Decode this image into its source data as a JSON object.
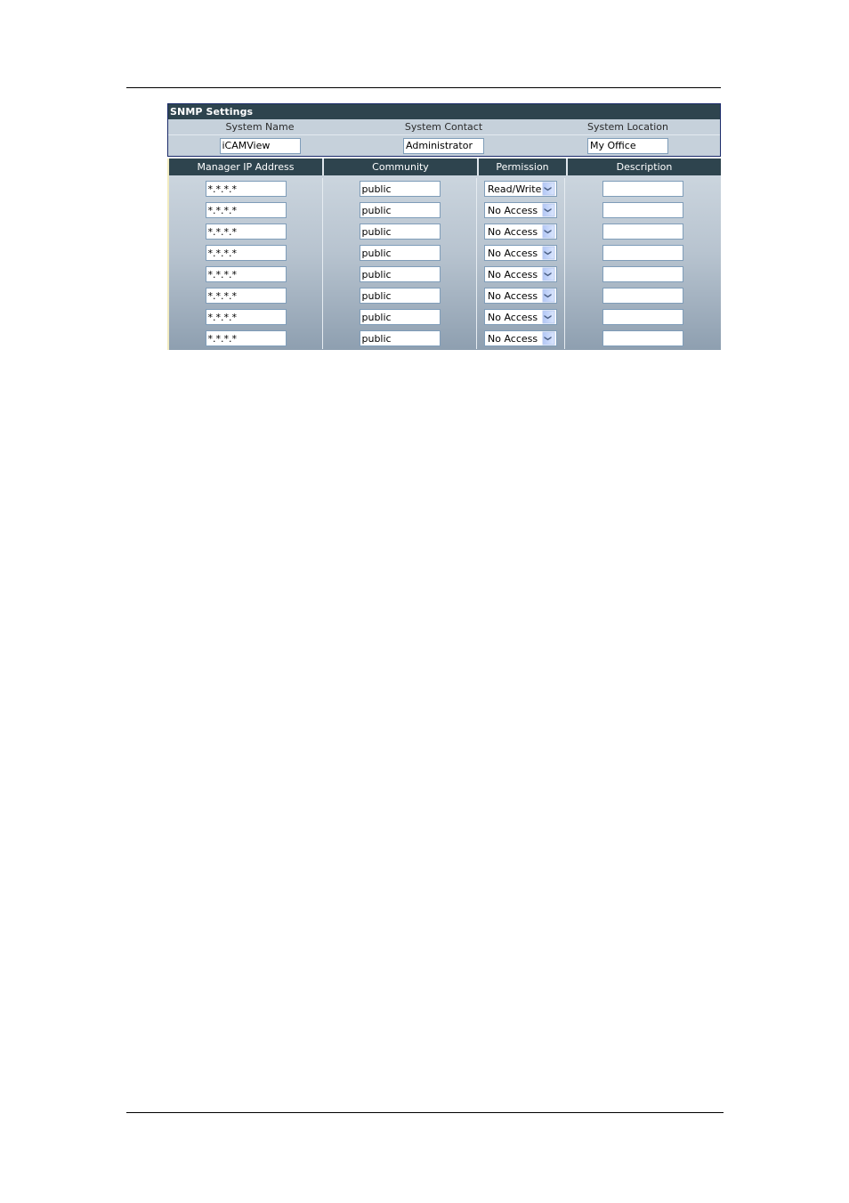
{
  "panel": {
    "title": "SNMP Settings",
    "system_fields": [
      {
        "label": "System Name",
        "value": "iCAMView"
      },
      {
        "label": "System Contact",
        "value": "Administrator"
      },
      {
        "label": "System Location",
        "value": "My Office"
      }
    ],
    "table": {
      "columns": [
        "Manager IP Address",
        "Community",
        "Permission",
        "Description"
      ],
      "rows": [
        {
          "ip": "*.*.*.*",
          "community": "public",
          "permission": "Read/Write",
          "description": ""
        },
        {
          "ip": "*.*.*.*",
          "community": "public",
          "permission": "No Access",
          "description": ""
        },
        {
          "ip": "*.*.*.*",
          "community": "public",
          "permission": "No Access",
          "description": ""
        },
        {
          "ip": "*.*.*.*",
          "community": "public",
          "permission": "No Access",
          "description": ""
        },
        {
          "ip": "*.*.*.*",
          "community": "public",
          "permission": "No Access",
          "description": ""
        },
        {
          "ip": "*.*.*.*",
          "community": "public",
          "permission": "No Access",
          "description": ""
        },
        {
          "ip": "*.*.*.*",
          "community": "public",
          "permission": "No Access",
          "description": ""
        },
        {
          "ip": "*.*.*.*",
          "community": "public",
          "permission": "No Access",
          "description": ""
        }
      ]
    },
    "dropdown_icon": "chevron-down-icon"
  }
}
